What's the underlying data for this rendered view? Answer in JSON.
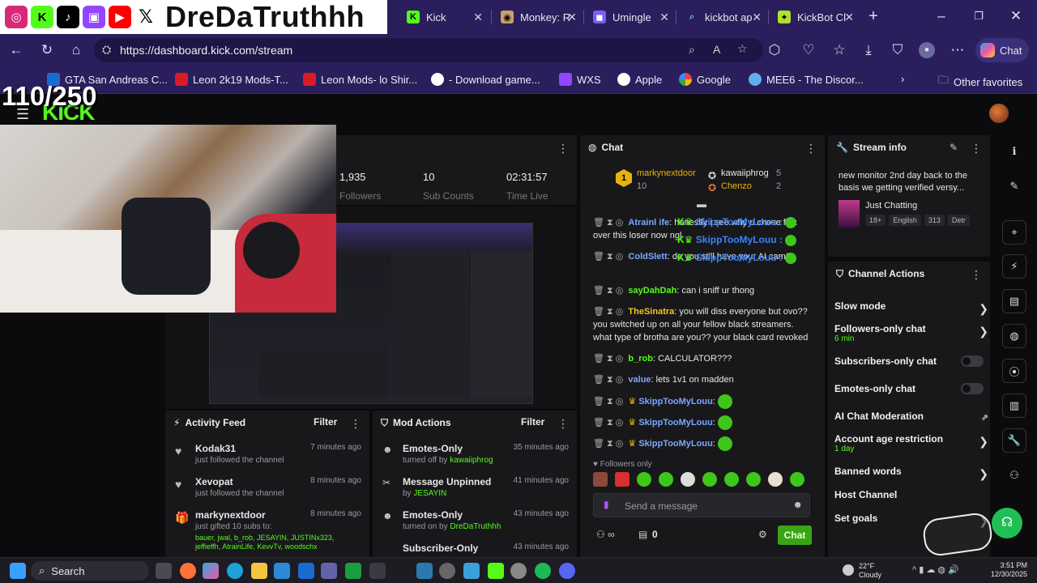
{
  "browser": {
    "tabs": [
      {
        "label": "Kick",
        "color": "#53fc18"
      },
      {
        "label": "Monkey: R",
        "color": "#c9a06b"
      },
      {
        "label": "Umingle",
        "color": "#7b5cff"
      },
      {
        "label": "kickbot ap",
        "color": "#3b82f6"
      },
      {
        "label": "KickBot Cl",
        "color": "#b3e02a"
      }
    ],
    "url": "https://dashboard.kick.com/stream",
    "chat_button": "Chat",
    "bookmarks": [
      "GTA San Andreas C...",
      "Leon 2k19 Mods-T...",
      "Leon Mods- lo Shir...",
      "- Download game...",
      "WXS",
      "Apple",
      "Google",
      "MEE6 - The Discor..."
    ],
    "other_favorites": "Other favorites"
  },
  "overlay": {
    "handle": "DreDaTruthhh",
    "goal": "110/250",
    "logo": "KICK"
  },
  "stats": {
    "followers": "1,935",
    "followers_label": "Followers",
    "subs": "10",
    "subs_label": "Sub Counts",
    "time": "02:31:57",
    "time_label": "Time Live"
  },
  "chat": {
    "title": "Chat",
    "leader": {
      "name": "markynextdoor",
      "count": "10"
    },
    "top2": {
      "name": "kawaiiphrog",
      "count": "5"
    },
    "top3": {
      "name": "Chenzo",
      "count": "2"
    },
    "pinned": [
      {
        "user": "SkippTooMyLouu"
      },
      {
        "user": "SkippTooMyLouu"
      },
      {
        "user": "SkippTooMyLouu"
      }
    ],
    "messages": [
      {
        "user": "Atrainl ife",
        "text": "honestly i see why u chose flax over this loser now ngl",
        "color": "#7aa7ff"
      },
      {
        "user": "ColdSlett",
        "text": "do you still have your AI cam?",
        "color": "#7aa7ff"
      },
      {
        "user": "sayDahDah",
        "text": "can i sniff ur thong",
        "color": "#53fc18"
      },
      {
        "user": "TheSinatra",
        "text": "you will diss everyone but ovo?? you switched up on all your fellow black streamers. what type of brotha are you?? your black card revoked",
        "color": "#f5c518"
      },
      {
        "user": "b_rob",
        "text": "CALCULATOR???",
        "color": "#53fc18"
      },
      {
        "user": "value",
        "text": "lets 1v1 on madden",
        "color": "#7aa7ff"
      },
      {
        "user": "SkippTooMyLouu",
        "text": "",
        "color": "#7aa7ff"
      },
      {
        "user": "SkippTooMyLouu",
        "text": "",
        "color": "#7aa7ff"
      },
      {
        "user": "SkippTooMyLouu",
        "text": "",
        "color": "#7aa7ff"
      }
    ],
    "followers_only": "Followers only",
    "placeholder": "Send a message",
    "send": "Chat",
    "count": "0"
  },
  "stream_info": {
    "title_label": "Stream info",
    "title": "new monitor 2nd day back to the basis we getting verified versy...",
    "category": "Just Chatting",
    "tags": [
      "18+",
      "English",
      "313",
      "Detr"
    ]
  },
  "channel_actions": {
    "title": "Channel Actions",
    "items": [
      {
        "label": "Slow mode",
        "sub": "",
        "kind": "chevron"
      },
      {
        "label": "Followers-only chat",
        "sub": "6 min",
        "kind": "chevron"
      },
      {
        "label": "Subscribers-only chat",
        "sub": "",
        "kind": "toggle"
      },
      {
        "label": "Emotes-only chat",
        "sub": "",
        "kind": "toggle"
      },
      {
        "label": "AI Chat Moderation",
        "sub": "",
        "kind": "external"
      },
      {
        "label": "Account age restriction",
        "sub": "1 day",
        "kind": "chevron"
      },
      {
        "label": "Banned words",
        "sub": "",
        "kind": "chevron"
      },
      {
        "label": "Host Channel",
        "sub": "",
        "kind": "none"
      },
      {
        "label": "Set goals",
        "sub": "",
        "kind": "chevron"
      }
    ]
  },
  "activity": {
    "title": "Activity Feed",
    "filter": "Filter",
    "items": [
      {
        "user": "Kodak31",
        "text": "just followed the channel",
        "time": "7 minutes ago"
      },
      {
        "user": "Xevopat",
        "text": "just followed the channel",
        "time": "8 minutes ago"
      },
      {
        "user": "markynextdoor",
        "text": "just gifted 10 subs to:",
        "time": "8 minutes ago",
        "gift_count": "10",
        "recipients": "bauer, jwal, b_rob, JESAYIN, JUSTINx323, jeffieffh, AtrainLife, KevvTv, woodschx"
      }
    ]
  },
  "mod": {
    "title": "Mod Actions",
    "filter": "Filter",
    "items": [
      {
        "action": "Emotes-Only",
        "detail_pre": "turned off by",
        "by": "kawaiiphrog",
        "time": "35 minutes ago"
      },
      {
        "action": "Message Unpinned",
        "detail_pre": "by",
        "by": "JESAYIN",
        "time": "41 minutes ago"
      },
      {
        "action": "Emotes-Only",
        "detail_pre": "turned on by",
        "by": "DreDaTruthhh",
        "time": "43 minutes ago"
      },
      {
        "action": "Subscriber-Only",
        "detail_pre": "",
        "by": "",
        "time": "43 minutes ago"
      }
    ]
  },
  "taskbar": {
    "search": "Search",
    "weather_temp": "22°F",
    "weather_desc": "Cloudy",
    "time": "3:51 PM",
    "date": "12/30/2025"
  },
  "colors": {
    "kick_green": "#53fc18",
    "browser_purple": "#2a1f5c",
    "panel": "#18181b"
  }
}
